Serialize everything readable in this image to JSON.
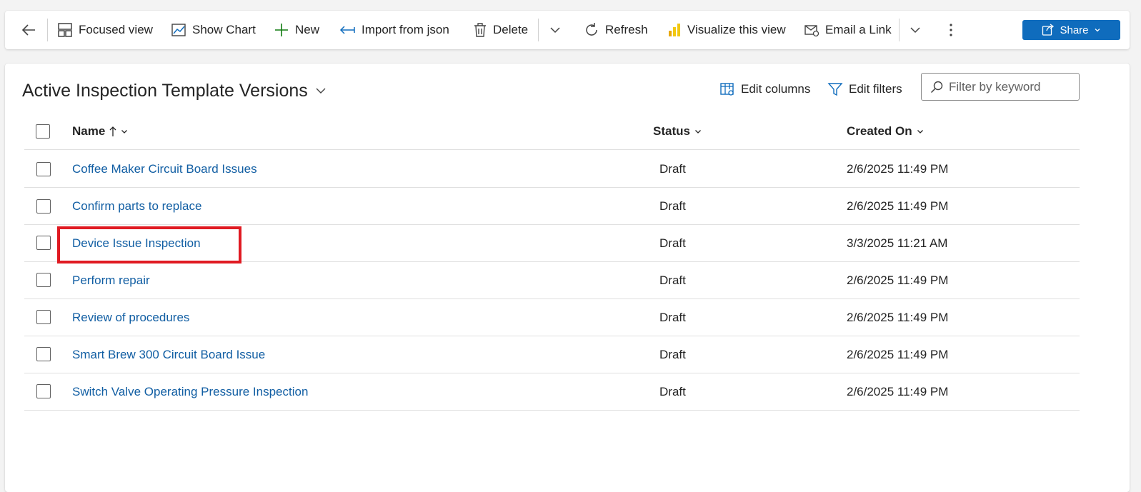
{
  "toolbar": {
    "back_label": "Back",
    "focused_view": "Focused view",
    "show_chart": "Show Chart",
    "new": "New",
    "import_json": "Import from json",
    "delete": "Delete",
    "refresh": "Refresh",
    "visualize": "Visualize this view",
    "email_link": "Email a Link",
    "share": "Share"
  },
  "view": {
    "title": "Active Inspection Template Versions",
    "edit_columns": "Edit columns",
    "edit_filters": "Edit filters",
    "filter_placeholder": "Filter by keyword"
  },
  "columns": {
    "name": "Name",
    "status": "Status",
    "created_on": "Created On"
  },
  "rows": [
    {
      "name": "Coffee Maker Circuit Board Issues",
      "status": "Draft",
      "created_on": "2/6/2025 11:49 PM"
    },
    {
      "name": "Confirm parts to replace",
      "status": "Draft",
      "created_on": "2/6/2025 11:49 PM"
    },
    {
      "name": "Device Issue Inspection",
      "status": "Draft",
      "created_on": "3/3/2025 11:21 AM"
    },
    {
      "name": "Perform repair",
      "status": "Draft",
      "created_on": "2/6/2025 11:49 PM"
    },
    {
      "name": "Review of procedures",
      "status": "Draft",
      "created_on": "2/6/2025 11:49 PM"
    },
    {
      "name": "Smart Brew 300 Circuit Board Issue",
      "status": "Draft",
      "created_on": "2/6/2025 11:49 PM"
    },
    {
      "name": "Switch Valve Operating Pressure Inspection",
      "status": "Draft",
      "created_on": "2/6/2025 11:49 PM"
    }
  ],
  "colors": {
    "accent": "#0f6cbd",
    "link": "#115ea3",
    "highlight": "#e01a22"
  }
}
